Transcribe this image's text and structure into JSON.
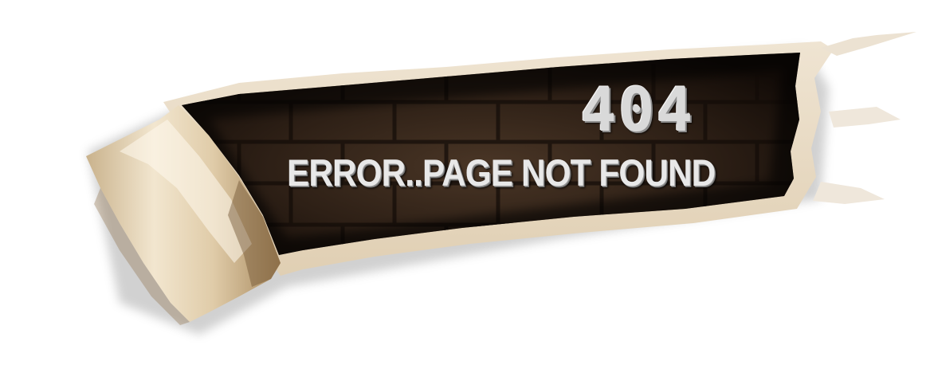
{
  "error": {
    "code": "404",
    "message": "ERROR..PAGE NOT FOUND"
  },
  "colors": {
    "paper": "#e9dcc6",
    "paper_edge": "#f5ede0",
    "curl_light": "#efe1c6",
    "curl_dark": "#a88a5f",
    "wall_dark": "#1e140d",
    "wall_mid": "#3b2a1d",
    "text": "#e8e8e8"
  },
  "icons": {
    "illustration": "torn-paper-brick-wall"
  }
}
